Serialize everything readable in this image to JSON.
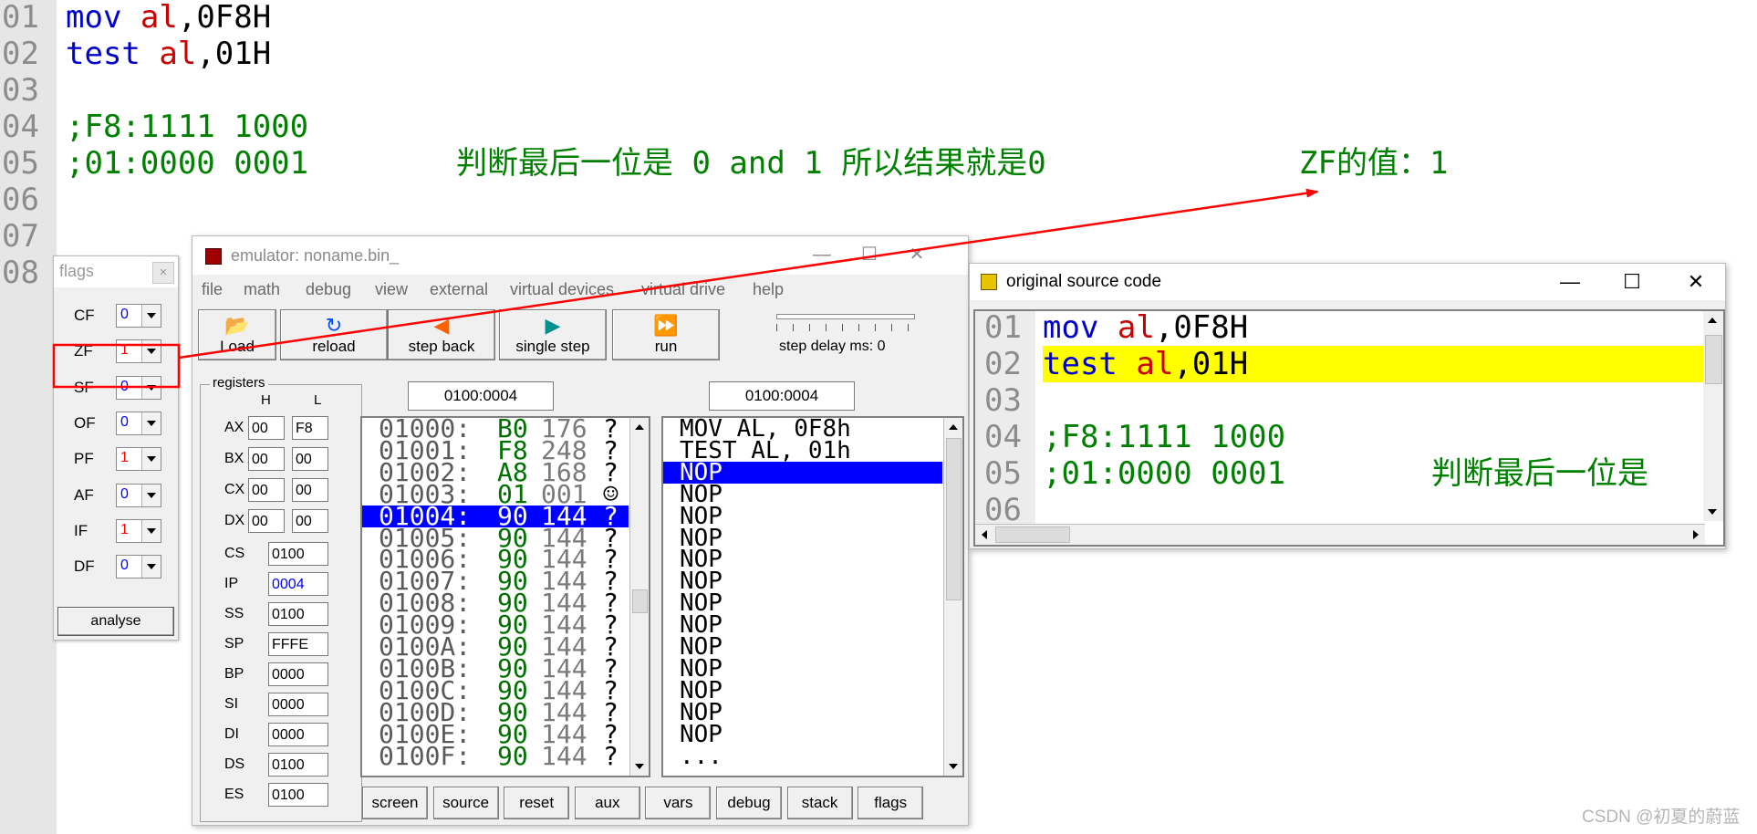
{
  "editor": {
    "lines": [
      {
        "n": "01",
        "kw": "mov",
        "reg": "al",
        "rest": ",0F8H"
      },
      {
        "n": "02",
        "kw": "test",
        "reg": "al",
        "rest": ",01H"
      },
      {
        "n": "03"
      },
      {
        "n": "04",
        "comment": ";F8:1111 1000"
      },
      {
        "n": "05",
        "comment": ";01:0000 0001",
        "note": "判断最后一位是 0 and 1 所以结果就是0",
        "zf": "ZF的值：1"
      },
      {
        "n": "06"
      },
      {
        "n": "07"
      },
      {
        "n": "08"
      }
    ]
  },
  "flags_window": {
    "title": "flags",
    "close": "×",
    "flags": [
      {
        "name": "CF",
        "value": "0",
        "color": "#0000ff"
      },
      {
        "name": "ZF",
        "value": "1",
        "color": "#ff0000"
      },
      {
        "name": "SF",
        "value": "0",
        "color": "#0000ff"
      },
      {
        "name": "OF",
        "value": "0",
        "color": "#0000ff"
      },
      {
        "name": "PF",
        "value": "1",
        "color": "#ff0000"
      },
      {
        "name": "AF",
        "value": "0",
        "color": "#0000ff"
      },
      {
        "name": "IF",
        "value": "1",
        "color": "#ff0000"
      },
      {
        "name": "DF",
        "value": "0",
        "color": "#0000ff"
      }
    ],
    "analyse_label": "analyse"
  },
  "emulator": {
    "title": "emulator: noname.bin_",
    "controls": {
      "minimize": "—",
      "maximize": "☐",
      "close": "✕"
    },
    "menu": [
      "file",
      "math",
      "debug",
      "view",
      "external",
      "virtual devices",
      "virtual drive",
      "help"
    ],
    "toolbar": [
      {
        "label": "Load",
        "icon": "open-folder-icon"
      },
      {
        "label": "reload",
        "icon": "reload-icon"
      },
      {
        "label": "step back",
        "icon": "step-back-icon"
      },
      {
        "label": "single step",
        "icon": "single-step-icon"
      },
      {
        "label": "run",
        "icon": "run-icon"
      }
    ],
    "step_delay_label": "step delay ms: 0",
    "registers": {
      "caption": "registers",
      "h": "H",
      "l": "L",
      "pairs": [
        {
          "name": "AX",
          "h": "00",
          "l": "F8"
        },
        {
          "name": "BX",
          "h": "00",
          "l": "00"
        },
        {
          "name": "CX",
          "h": "00",
          "l": "00"
        },
        {
          "name": "DX",
          "h": "00",
          "l": "00"
        }
      ],
      "singles": [
        {
          "name": "CS",
          "value": "0100"
        },
        {
          "name": "IP",
          "value": "0004",
          "color": "#0000ff"
        },
        {
          "name": "SS",
          "value": "0100"
        },
        {
          "name": "SP",
          "value": "FFFE"
        },
        {
          "name": "BP",
          "value": "0000"
        },
        {
          "name": "SI",
          "value": "0000"
        },
        {
          "name": "DI",
          "value": "0000"
        },
        {
          "name": "DS",
          "value": "0100"
        },
        {
          "name": "ES",
          "value": "0100"
        }
      ]
    },
    "mem_address": "0100:0004",
    "dis_address": "0100:0004",
    "memory": [
      {
        "addr": "01000:",
        "hex": "B0",
        "dec": "176",
        "chr": "?"
      },
      {
        "addr": "01001:",
        "hex": "F8",
        "dec": "248",
        "chr": "?"
      },
      {
        "addr": "01002:",
        "hex": "A8",
        "dec": "168",
        "chr": "?"
      },
      {
        "addr": "01003:",
        "hex": "01",
        "dec": "001",
        "chr": "☺"
      },
      {
        "addr": "01004:",
        "hex": "90",
        "dec": "144",
        "chr": "?",
        "selected": true
      },
      {
        "addr": "01005:",
        "hex": "90",
        "dec": "144",
        "chr": "?"
      },
      {
        "addr": "01006:",
        "hex": "90",
        "dec": "144",
        "chr": "?"
      },
      {
        "addr": "01007:",
        "hex": "90",
        "dec": "144",
        "chr": "?"
      },
      {
        "addr": "01008:",
        "hex": "90",
        "dec": "144",
        "chr": "?"
      },
      {
        "addr": "01009:",
        "hex": "90",
        "dec": "144",
        "chr": "?"
      },
      {
        "addr": "0100A:",
        "hex": "90",
        "dec": "144",
        "chr": "?"
      },
      {
        "addr": "0100B:",
        "hex": "90",
        "dec": "144",
        "chr": "?"
      },
      {
        "addr": "0100C:",
        "hex": "90",
        "dec": "144",
        "chr": "?"
      },
      {
        "addr": "0100D:",
        "hex": "90",
        "dec": "144",
        "chr": "?"
      },
      {
        "addr": "0100E:",
        "hex": "90",
        "dec": "144",
        "chr": "?"
      },
      {
        "addr": "0100F:",
        "hex": "90",
        "dec": "144",
        "chr": "?"
      }
    ],
    "disassembly": [
      {
        "text": "MOV AL, 0F8h"
      },
      {
        "text": "TEST AL, 01h"
      },
      {
        "text": "NOP",
        "selected": true
      },
      {
        "text": "NOP"
      },
      {
        "text": "NOP"
      },
      {
        "text": "NOP"
      },
      {
        "text": "NOP"
      },
      {
        "text": "NOP"
      },
      {
        "text": "NOP"
      },
      {
        "text": "NOP"
      },
      {
        "text": "NOP"
      },
      {
        "text": "NOP"
      },
      {
        "text": "NOP"
      },
      {
        "text": "NOP"
      },
      {
        "text": "NOP"
      },
      {
        "text": "..."
      }
    ],
    "bottom_buttons": [
      "screen",
      "source",
      "reset",
      "aux",
      "vars",
      "debug",
      "stack",
      "flags"
    ]
  },
  "source_window": {
    "title": "original source code",
    "controls": {
      "minimize": "—",
      "maximize": "☐",
      "close": "✕"
    },
    "lines": [
      {
        "n": "01",
        "kw": "mov",
        "reg": "al",
        "rest": ",0F8H"
      },
      {
        "n": "02",
        "kw": "test",
        "reg": "al",
        "rest": ",01H",
        "highlighted": true
      },
      {
        "n": "03"
      },
      {
        "n": "04",
        "comment": ";F8:1111 1000"
      },
      {
        "n": "05",
        "comment": ";01:0000 0001",
        "note": "判断最后一位是"
      },
      {
        "n": "06"
      }
    ]
  },
  "watermark": "CSDN @初夏的蔚蓝",
  "colors": {
    "annotation": "#ff0000",
    "highlight": "#ffff00",
    "selection": "#0000ff"
  }
}
